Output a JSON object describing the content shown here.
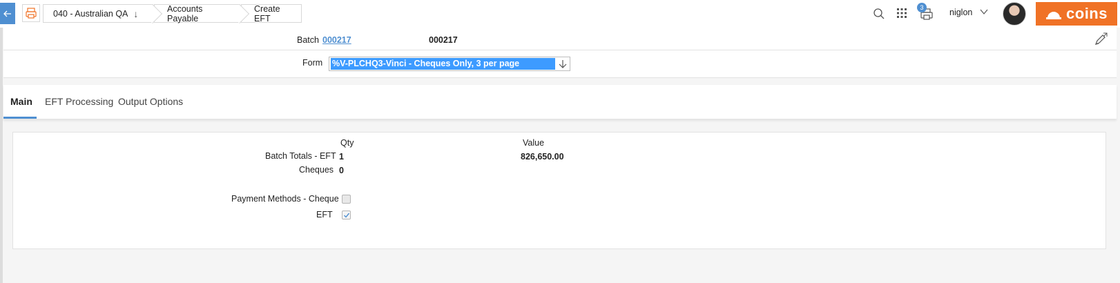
{
  "toolbar": {
    "breadcrumbs": [
      {
        "label": "040 - Australian QA"
      },
      {
        "label": "Accounts Payable"
      },
      {
        "label": "Create EFT"
      }
    ],
    "notification_count": "3",
    "username": "niglon",
    "logo_text": "coins"
  },
  "header": {
    "batch_label": "Batch",
    "batch_link": "000217",
    "batch_value": "000217",
    "form_label": "Form",
    "form_value": "%V-PLCHQ3-Vinci - Cheques Only, 3 per page"
  },
  "tabs": [
    {
      "label": "Main",
      "active": true
    },
    {
      "label": "EFT Processing",
      "active": false
    },
    {
      "label": "Output Options",
      "active": false
    }
  ],
  "main": {
    "qty_header": "Qty",
    "value_header": "Value",
    "batch_totals_eft_label": "Batch Totals - EFT",
    "batch_totals_eft_qty": "1",
    "batch_totals_eft_value": "826,650.00",
    "cheques_label": "Cheques",
    "cheques_qty": "0",
    "payment_methods_cheque_label": "Payment Methods - Cheque",
    "payment_methods_cheque_checked": false,
    "eft_label": "EFT",
    "eft_checked": true
  },
  "colors": {
    "accent": "#4f8fd1",
    "brand": "#f07226",
    "selection": "#3d9bff"
  }
}
